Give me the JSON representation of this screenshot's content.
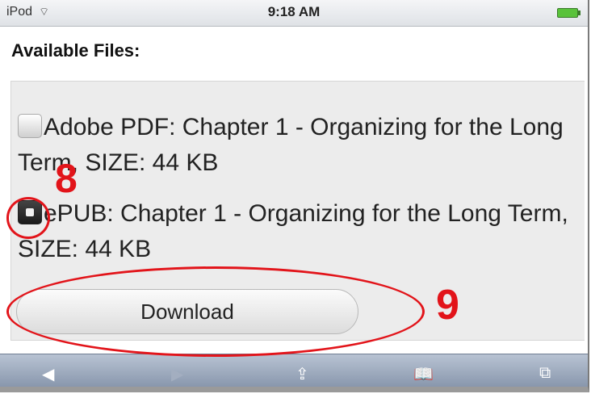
{
  "status_bar": {
    "carrier": "iPod",
    "time": "9:18 AM",
    "wifi_icon": "wifi-icon",
    "battery_icon": "battery-icon"
  },
  "heading": "Available Files:",
  "options": [
    {
      "label": "Adobe PDF: Chapter 1 - Organizing for the Long Term, SIZE: 44 KB",
      "checked": false
    },
    {
      "label": "ePUB: Chapter 1 - Organizing for the Long Term, SIZE: 44 KB",
      "checked": true
    }
  ],
  "download_button": "Download",
  "annotations": {
    "step1": "8",
    "step2": "9",
    "color": "#e2141a"
  },
  "toolbar": {
    "back_icon": "◀",
    "forward_icon": "▶",
    "share_icon": "⇪",
    "bookmarks_icon": "📖",
    "pages_icon": "⧉"
  }
}
